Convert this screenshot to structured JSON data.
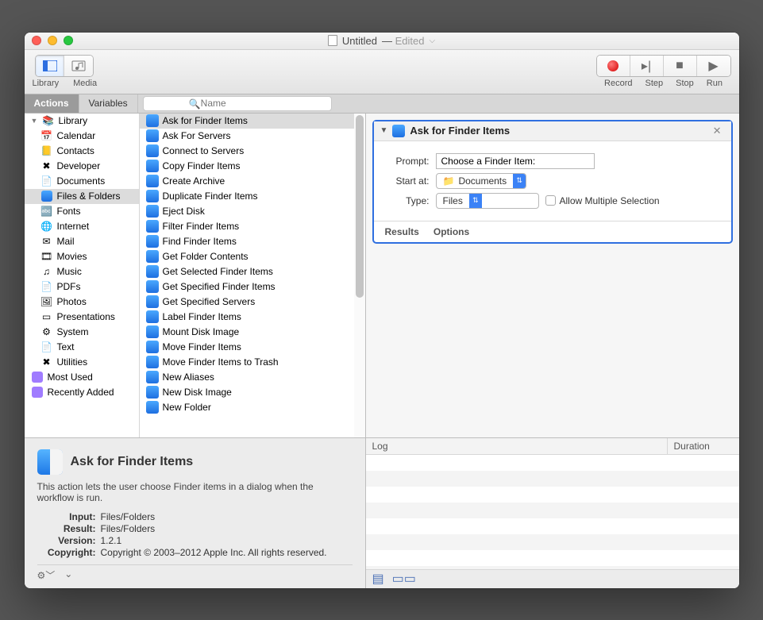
{
  "titlebar": {
    "filename": "Untitled",
    "state": "Edited"
  },
  "toolbar": {
    "library_label": "Library",
    "media_label": "Media",
    "record_label": "Record",
    "step_label": "Step",
    "stop_label": "Stop",
    "run_label": "Run"
  },
  "tabs": {
    "actions": "Actions",
    "variables": "Variables"
  },
  "search": {
    "placeholder": "Name"
  },
  "library": {
    "root": "Library",
    "items": [
      "Calendar",
      "Contacts",
      "Developer",
      "Documents",
      "Files & Folders",
      "Fonts",
      "Internet",
      "Mail",
      "Movies",
      "Music",
      "PDFs",
      "Photos",
      "Presentations",
      "System",
      "Text",
      "Utilities"
    ],
    "selected": "Files & Folders",
    "extras": [
      "Most Used",
      "Recently Added"
    ]
  },
  "action_list": {
    "items": [
      "Ask for Finder Items",
      "Ask For Servers",
      "Connect to Servers",
      "Copy Finder Items",
      "Create Archive",
      "Duplicate Finder Items",
      "Eject Disk",
      "Filter Finder Items",
      "Find Finder Items",
      "Get Folder Contents",
      "Get Selected Finder Items",
      "Get Specified Finder Items",
      "Get Specified Servers",
      "Label Finder Items",
      "Mount Disk Image",
      "Move Finder Items",
      "Move Finder Items to Trash",
      "New Aliases",
      "New Disk Image",
      "New Folder"
    ],
    "selected": "Ask for Finder Items"
  },
  "description": {
    "title": "Ask for Finder Items",
    "blurb": "This action lets the user choose Finder items in a dialog when the workflow is run.",
    "input_label": "Input:",
    "input": "Files/Folders",
    "result_label": "Result:",
    "result": "Files/Folders",
    "version_label": "Version:",
    "version": "1.2.1",
    "copyright_label": "Copyright:",
    "copyright": "Copyright © 2003–2012 Apple Inc.  All rights reserved."
  },
  "workflow_action": {
    "title": "Ask for Finder Items",
    "prompt_label": "Prompt:",
    "prompt_value": "Choose a Finder Item:",
    "start_label": "Start at:",
    "start_value": "Documents",
    "type_label": "Type:",
    "type_value": "Files",
    "allow_multi": "Allow Multiple Selection",
    "results": "Results",
    "options": "Options"
  },
  "log": {
    "col1": "Log",
    "col2": "Duration"
  }
}
